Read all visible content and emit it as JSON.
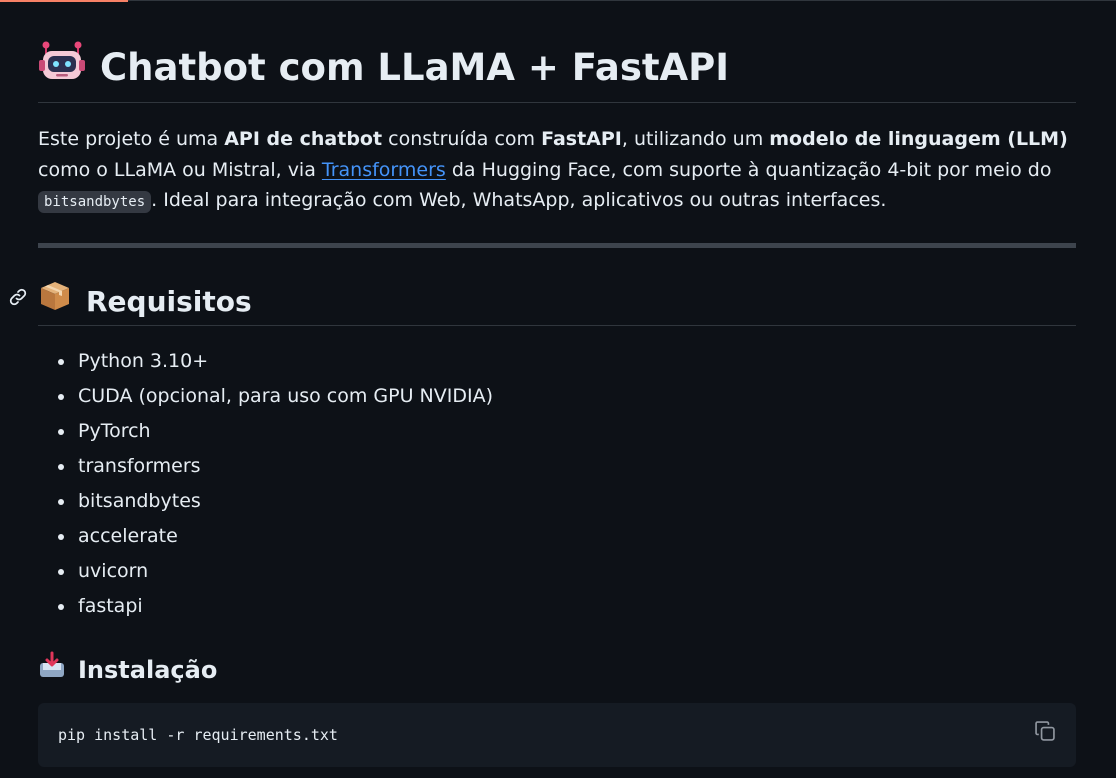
{
  "title": {
    "emoji": "robot-icon",
    "text": "Chatbot com LLaMA + FastAPI"
  },
  "intro": {
    "t1": "Este projeto é uma ",
    "b1": "API de chatbot",
    "t2": " construída com ",
    "b2": "FastAPI",
    "t3": ", utilizando um ",
    "b3": "modelo de linguagem (LLM)",
    "t4": " como o LLaMA ou Mistral, via ",
    "link": "Transformers",
    "t5": " da Hugging Face, com suporte à quantização 4-bit por meio do ",
    "code": "bitsandbytes",
    "t6": ". Ideal para integração com Web, WhatsApp, aplicativos ou outras interfaces."
  },
  "requirements": {
    "heading": "Requisitos",
    "icon": "package-icon",
    "items": [
      "Python 3.10+",
      "CUDA (opcional, para uso com GPU NVIDIA)",
      "PyTorch",
      "transformers",
      "bitsandbytes",
      "accelerate",
      "uvicorn",
      "fastapi"
    ]
  },
  "install": {
    "heading": "Instalação",
    "icon": "inbox-tray-icon",
    "code": "pip install -r requirements.txt"
  },
  "colors": {
    "background": "#0d1117",
    "text": "#e6edf3",
    "link": "#4493f8",
    "code_bg": "#151b23"
  }
}
